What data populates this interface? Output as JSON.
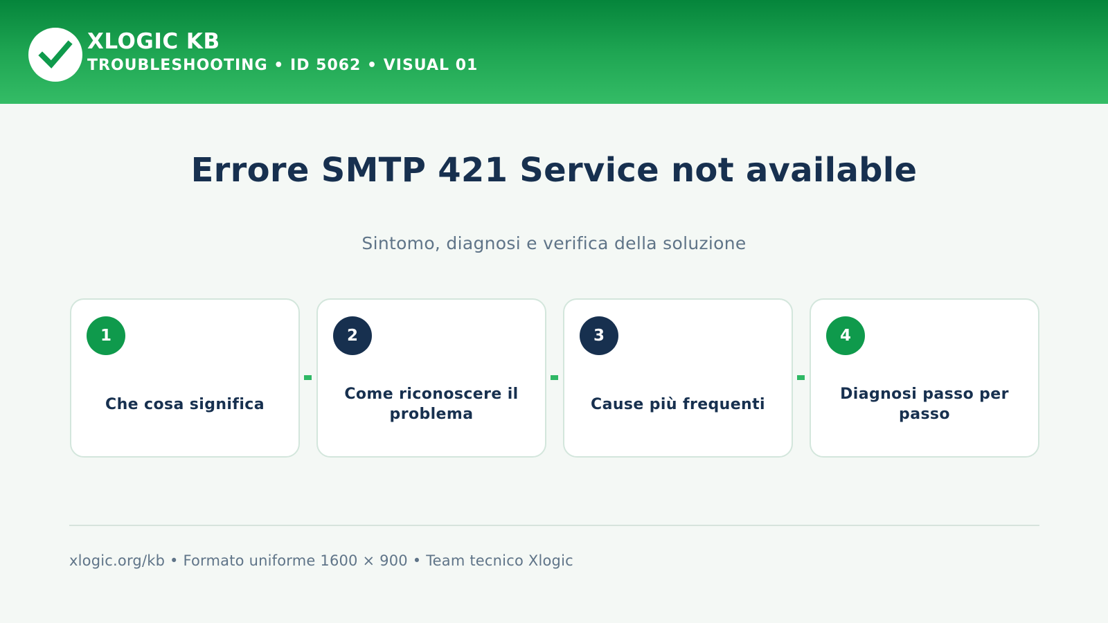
{
  "header": {
    "brand": "XLOGIC KB",
    "tagline": "TROUBLESHOOTING • ID 5062 • VISUAL 01",
    "logo_icon": "checkmark-icon",
    "colors": {
      "gradient_top": "#05853b",
      "gradient_bottom": "#34bc66"
    }
  },
  "main": {
    "title": "Errore SMTP 421 Service not available",
    "subtitle": "Sintomo, diagnosi e verifica della soluzione"
  },
  "steps": [
    {
      "number": "1",
      "label": "Che cosa significa",
      "badge_color": "#0f9a4c"
    },
    {
      "number": "2",
      "label": "Come riconoscere il problema",
      "badge_color": "#17304f"
    },
    {
      "number": "3",
      "label": "Cause più frequenti",
      "badge_color": "#17304f"
    },
    {
      "number": "4",
      "label": "Diagnosi passo per passo",
      "badge_color": "#0f9a4c"
    }
  ],
  "footer": {
    "text": "xlogic.org/kb • Formato uniforme 1600 × 900 • Team tecnico Xlogic"
  }
}
